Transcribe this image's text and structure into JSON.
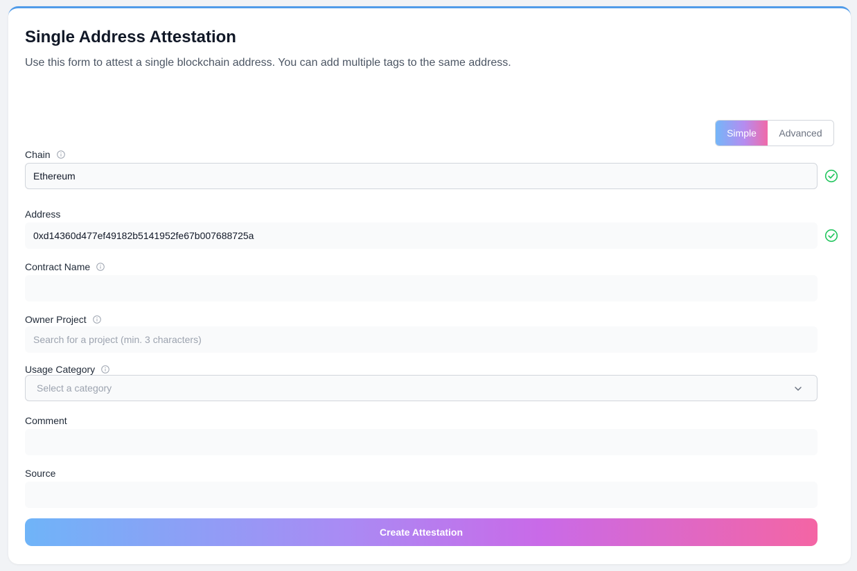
{
  "header": {
    "title": "Single Address Attestation",
    "subtitle": "Use this form to attest a single blockchain address. You can add multiple tags to the same address."
  },
  "mode_toggle": {
    "simple_label": "Simple",
    "advanced_label": "Advanced",
    "selected": "Simple"
  },
  "form": {
    "chain": {
      "label": "Chain",
      "value": "Ethereum",
      "valid": true
    },
    "address": {
      "label": "Address",
      "value": "0xd14360d477ef49182b5141952fe67b007688725a",
      "valid": true
    },
    "contract_name": {
      "label": "Contract Name",
      "value": ""
    },
    "owner_project": {
      "label": "Owner Project",
      "value": "",
      "placeholder": "Search for a project (min. 3 characters)"
    },
    "usage_category": {
      "label": "Usage Category",
      "placeholder": "Select a category"
    },
    "comment": {
      "label": "Comment",
      "value": ""
    },
    "source": {
      "label": "Source",
      "value": ""
    }
  },
  "submit": {
    "label": "Create Attestation"
  },
  "colors": {
    "accent_top": "#4f9be9",
    "gradient_start": "#6fb4f8",
    "gradient_end": "#f465a4",
    "valid_check": "#22c55e"
  },
  "icons": {
    "info": "info-icon",
    "valid": "check-circle-icon",
    "dropdown": "chevron-down-icon"
  }
}
